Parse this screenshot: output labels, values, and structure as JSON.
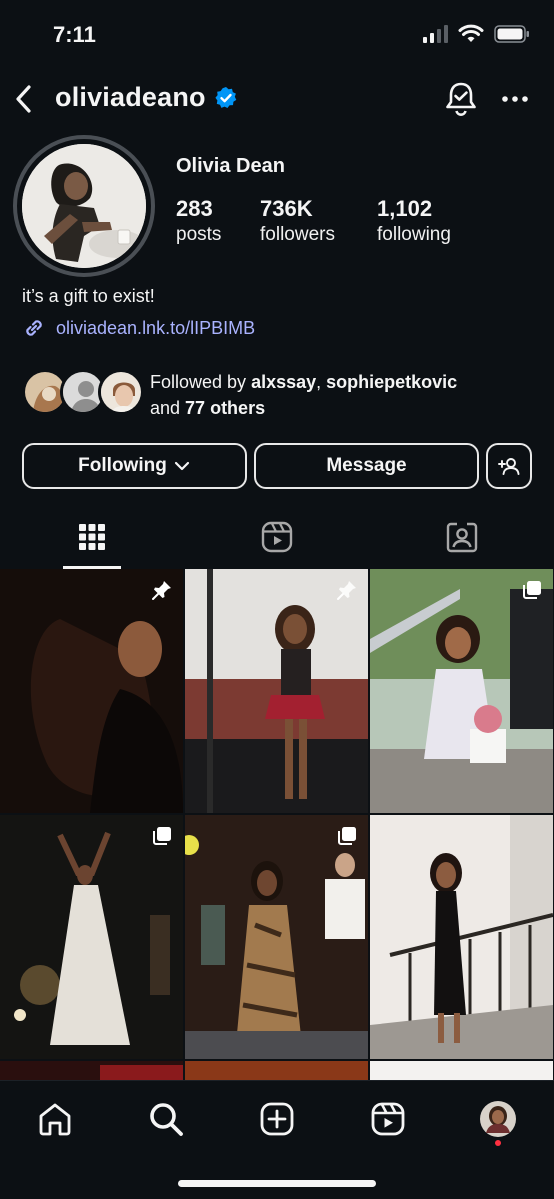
{
  "status_bar": {
    "time": "7:11"
  },
  "header": {
    "username": "oliviadeano"
  },
  "profile": {
    "display_name": "Olivia Dean",
    "stats": [
      {
        "value": "283",
        "label": "posts"
      },
      {
        "value": "736K",
        "label": "followers"
      },
      {
        "value": "1,102",
        "label": "following"
      }
    ],
    "bio": "it’s a gift to exist!",
    "link": "oliviadean.lnk.to/lIPBIMB",
    "followed_by": {
      "prefix": "Followed by ",
      "user1": "alxssay",
      "separator": ", ",
      "user2": "sophiepetkovic",
      "line2_prefix": "and ",
      "others": "77 others"
    }
  },
  "actions": {
    "following_label": "Following",
    "message_label": "Message"
  },
  "tabs": [
    "posts-grid-icon",
    "reels-icon",
    "tagged-icon"
  ],
  "colors": {
    "background": "#0c1014",
    "text": "#f5f5f5",
    "link": "#aab3ff",
    "verified": "#0095f6",
    "notification_dot": "#ff3040"
  },
  "bottom_nav": [
    "home-icon",
    "search-icon",
    "create-icon",
    "reels-icon",
    "profile-avatar"
  ]
}
